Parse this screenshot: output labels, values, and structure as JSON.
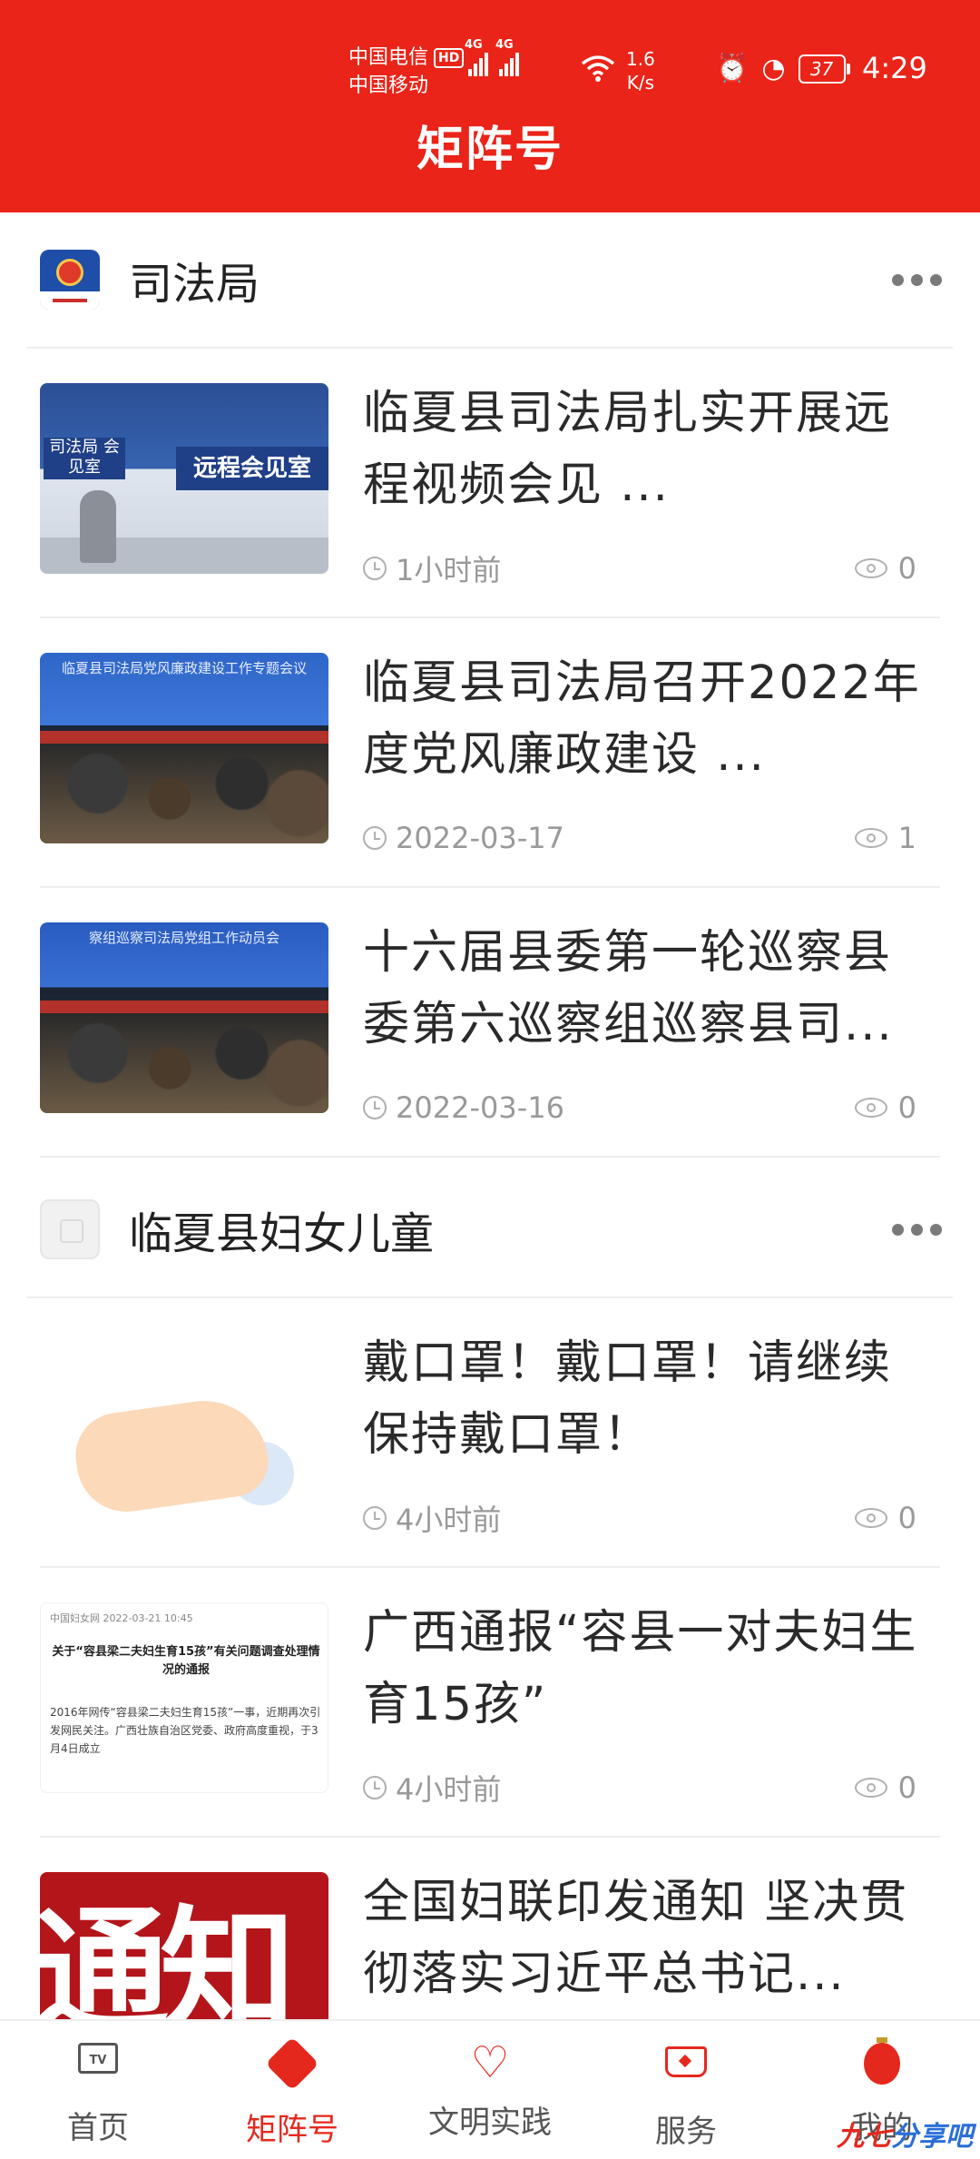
{
  "status_bar": {
    "carrier1": "中国电信",
    "carrier1_badge": "HD",
    "carrier2": "中国移动",
    "net1": "4G",
    "net2": "4G",
    "speed_value": "1.6",
    "speed_unit": "K/s",
    "battery": "37",
    "time": "4:29"
  },
  "header": {
    "title": "矩阵号"
  },
  "sections": [
    {
      "org_name": "司法局",
      "items": [
        {
          "title": "临夏县司法局扎实开展远程视频会见 ...",
          "time": "1小时前",
          "views": "0",
          "thumb_text": "远程会见室",
          "thumb_text2": "司法局 会见室"
        },
        {
          "title": "临夏县司法局召开2022年度党风廉政建设 ...",
          "time": "2022-03-17",
          "views": "1",
          "thumb_text": "临夏县司法局党风廉政建设工作专题会议"
        },
        {
          "title": "十六届县委第一轮巡察县委第六巡察组巡察县司...",
          "time": "2022-03-16",
          "views": "0",
          "thumb_text": "察组巡察司法局党组工作动员会"
        }
      ]
    },
    {
      "org_name": "临夏县妇女儿童",
      "items": [
        {
          "title": "戴口罩！戴口罩！请继续保持戴口罩！",
          "time": "4小时前",
          "views": "0"
        },
        {
          "title": "广西通报“容县一对夫妇生育15孩”",
          "time": "4小时前",
          "views": "0",
          "doc_source": "中国妇女网  2022-03-21 10:45",
          "doc_head": "关于“容县梁二夫妇生育15孩”有关问题调查处理情况的通报",
          "doc_body": "2016年网传“容县梁二夫妇生育15孩”一事，近期再次引发网民关注。广西壮族自治区党委、政府高度重视，于3月4日成立"
        },
        {
          "title": "全国妇联印发通知 坚决贯彻落实习近平总书记...",
          "thumb_text": "通知"
        }
      ]
    }
  ],
  "tabs": [
    {
      "label": "首页",
      "icon": "tv-icon",
      "icon_text": "TV"
    },
    {
      "label": "矩阵号",
      "icon": "matrix-icon"
    },
    {
      "label": "文明实践",
      "icon": "heart-icon"
    },
    {
      "label": "服务",
      "icon": "service-icon"
    },
    {
      "label": "我的",
      "icon": "lantern-icon"
    }
  ],
  "watermark": {
    "part1": "九七",
    "part2": "分享吧"
  },
  "colors": {
    "brand_red": "#ea2418",
    "accent_red": "#e5281d",
    "meta_gray": "#999999"
  }
}
